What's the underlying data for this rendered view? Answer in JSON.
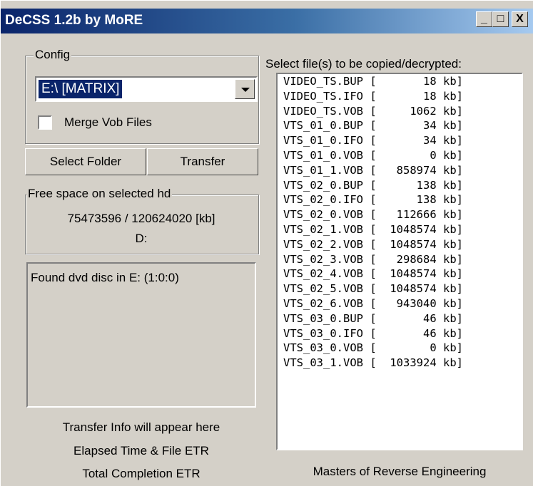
{
  "window": {
    "title": "DeCSS 1.2b by MoRE",
    "buttons": {
      "minimize": "_",
      "maximize": "□",
      "close": "X"
    }
  },
  "config": {
    "legend": "Config",
    "drive_selected": "E:\\ [MATRIX]",
    "merge_label": "Merge Vob Files",
    "merge_checked": false
  },
  "actions": {
    "select_folder": "Select Folder",
    "transfer": "Transfer"
  },
  "freespace": {
    "legend": "Free space on selected hd",
    "value": "75473596 / 120624020 [kb]",
    "drive": "D:"
  },
  "info": {
    "message": "Found dvd disc in E: (1:0:0)"
  },
  "status_lines": [
    "Transfer Info will appear here",
    "Elapsed Time & File ETR",
    "Total Completion ETR"
  ],
  "files": {
    "label": "Select file(s) to be copied/decrypted:",
    "items": [
      {
        "name": "VIDEO_TS.BUP",
        "size": "18"
      },
      {
        "name": "VIDEO_TS.IFO",
        "size": "18"
      },
      {
        "name": "VIDEO_TS.VOB",
        "size": "1062"
      },
      {
        "name": "VTS_01_0.BUP",
        "size": "34"
      },
      {
        "name": "VTS_01_0.IFO",
        "size": "34"
      },
      {
        "name": "VTS_01_0.VOB",
        "size": "0"
      },
      {
        "name": "VTS_01_1.VOB",
        "size": "858974"
      },
      {
        "name": "VTS_02_0.BUP",
        "size": "138"
      },
      {
        "name": "VTS_02_0.IFO",
        "size": "138"
      },
      {
        "name": "VTS_02_0.VOB",
        "size": "112666"
      },
      {
        "name": "VTS_02_1.VOB",
        "size": "1048574"
      },
      {
        "name": "VTS_02_2.VOB",
        "size": "1048574"
      },
      {
        "name": "VTS_02_3.VOB",
        "size": "298684"
      },
      {
        "name": "VTS_02_4.VOB",
        "size": "1048574"
      },
      {
        "name": "VTS_02_5.VOB",
        "size": "1048574"
      },
      {
        "name": "VTS_02_6.VOB",
        "size": "943040"
      },
      {
        "name": "VTS_03_0.BUP",
        "size": "46"
      },
      {
        "name": "VTS_03_0.IFO",
        "size": "46"
      },
      {
        "name": "VTS_03_0.VOB",
        "size": "0"
      },
      {
        "name": "VTS_03_1.VOB",
        "size": "1033924"
      }
    ],
    "unit": "kb"
  },
  "footer": "Masters of Reverse Engineering"
}
